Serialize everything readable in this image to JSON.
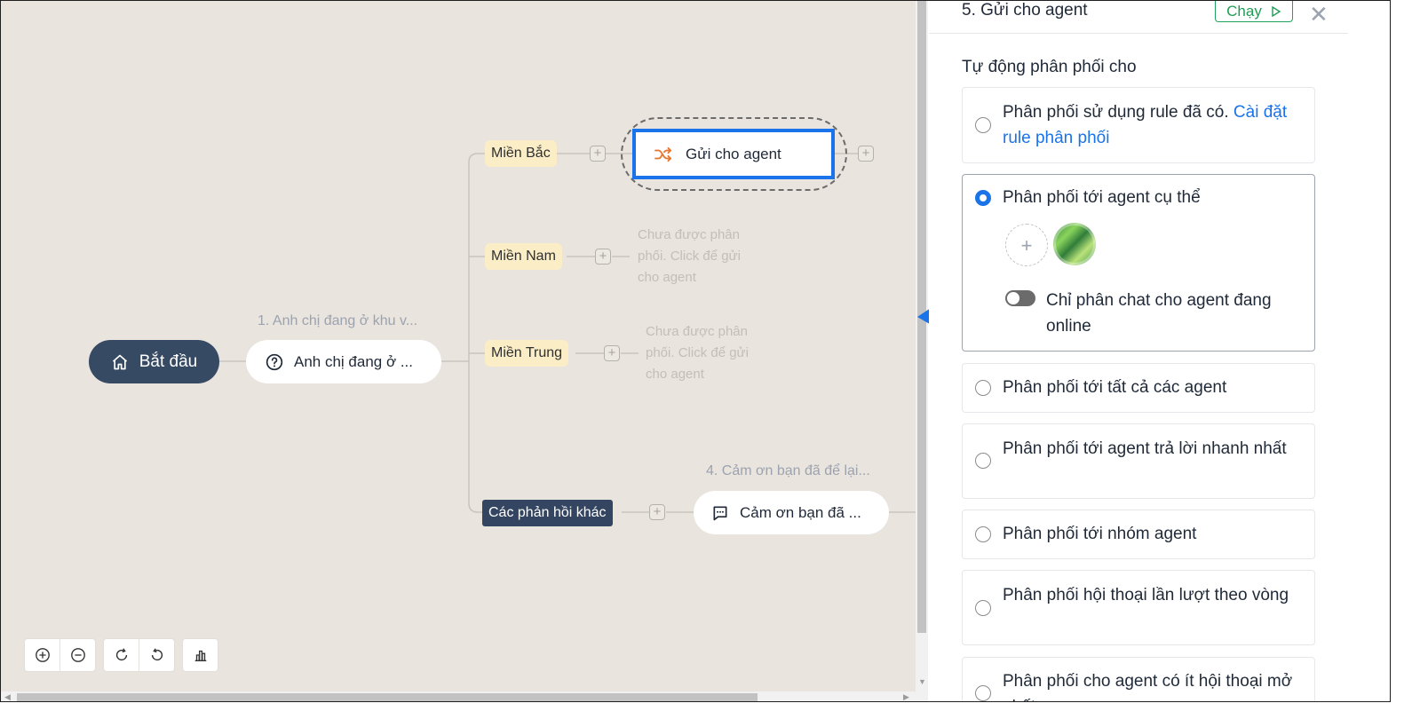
{
  "canvas": {
    "start_label": "Bắt đầu",
    "question_caption": "1. Anh chị đang ở khu v...",
    "question_label": "Anh chị đang ở ...",
    "branches": [
      {
        "label": "Miền Bắc"
      },
      {
        "label": "Miền Nam",
        "hint": "Chưa được phân phối. Click để gửi cho agent"
      },
      {
        "label": "Miền Trung",
        "hint": "Chưa được phân phối. Click để gửi cho agent"
      },
      {
        "label": "Các phản hồi khác"
      }
    ],
    "agent_node_label": "Gửi cho agent",
    "thanks_caption": "4. Cảm ơn bạn đã để lại...",
    "thanks_label": "Cảm ơn bạn đã ...",
    "plus_symbol": "+"
  },
  "toolbar": {
    "icons": [
      "zoom-in-icon",
      "zoom-out-icon",
      "rotate-cw-icon",
      "rotate-ccw-icon",
      "chart-bar-icon"
    ]
  },
  "panel": {
    "title": "5. Gửi cho agent",
    "run_label": "Chạy",
    "close_symbol": "✕",
    "section_label": "Tự động phân phối cho",
    "options": [
      {
        "text": "Phân phối sử dụng rule đã có.",
        "link": "Cài đặt rule phân phối",
        "selected": false
      },
      {
        "text": "Phân phối tới agent cụ thể",
        "selected": true
      },
      {
        "text": "Phân phối tới tất cả các agent",
        "selected": false
      },
      {
        "text": "Phân phối tới agent trả lời nhanh nhất",
        "selected": false
      },
      {
        "text": "Phân phối tới nhóm agent",
        "selected": false
      },
      {
        "text": "Phân phối hội thoại lần lượt theo vòng",
        "selected": false
      },
      {
        "text": "Phân phối cho agent có ít hội thoại mở nhất",
        "selected": false
      }
    ],
    "add_symbol": "+",
    "online_toggle_label": "Chỉ phân chat cho agent đang online",
    "online_toggle_on": false
  },
  "colors": {
    "canvas_bg": "#e9e4de",
    "start_bg": "#374a63",
    "tag_bg": "#fbeec6",
    "accent": "#1a73e8",
    "run_green": "#1f9d55"
  }
}
